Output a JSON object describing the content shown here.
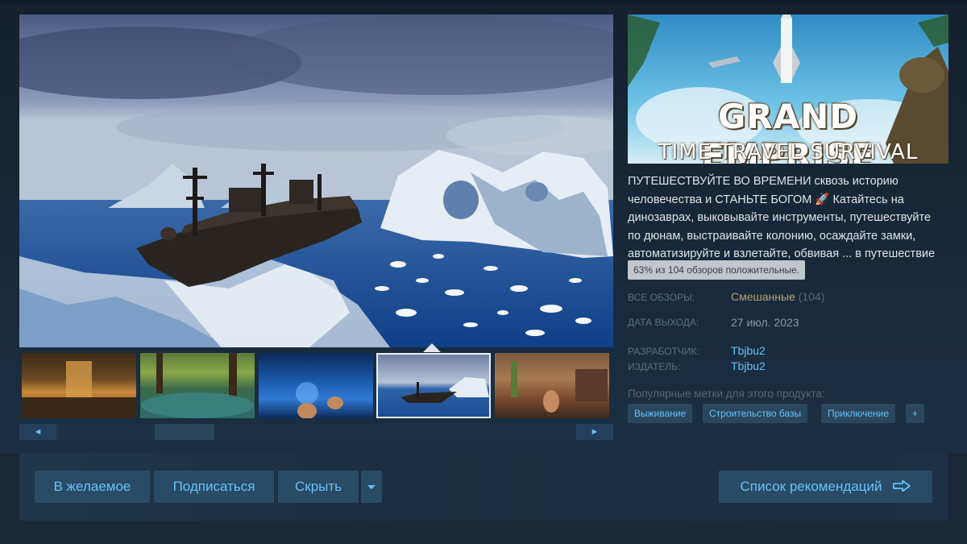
{
  "game": {
    "capsule_title_line1": "GRAND EMPRISE",
    "capsule_title_line2": "TIME TRAVEL SURVIVAL",
    "description": "ПУТЕШЕСТВУЙТЕ ВО ВРЕМЕНИ сквозь историю человечества и СТАНЬТЕ БОГОМ 🚀 Катайтесь на динозаврах, выковывайте инструменты, путешествуйте по дюнам, выстраивайте колонию, осаждайте замки, автоматизируйте и взлетайте, обвивая ... в путешествие про…"
  },
  "reviews": {
    "tooltip": "63% из 104 обзоров положительные.",
    "label": "ВСЕ ОБЗОРЫ:",
    "summary": "Смешанные",
    "count": "(104)"
  },
  "release": {
    "label": "ДАТА ВЫХОДА:",
    "date": "27 июл. 2023"
  },
  "developer": {
    "label": "РАЗРАБОТЧИК:",
    "name": "Tbjbu2"
  },
  "publisher": {
    "label": "ИЗДАТЕЛЬ:",
    "name": "Tbjbu2"
  },
  "tags": {
    "label": "Популярные метки для этого продукта:",
    "items": [
      "Выживание",
      "Строительство базы",
      "Приключение",
      "+"
    ]
  },
  "media": {
    "scroll_left": "◄",
    "scroll_right": "►",
    "selected_thumbnail_index": 3,
    "thumbnail_count": 5
  },
  "actions": {
    "wishlist": "В желаемое",
    "follow": "Подписаться",
    "ignore": "Скрыть",
    "queue": "Список рекомендаций"
  },
  "colors": {
    "background": "#1b2838",
    "link": "#66c0f4",
    "mixed_review": "#b9a074",
    "button_bg": "#2a4b66"
  }
}
